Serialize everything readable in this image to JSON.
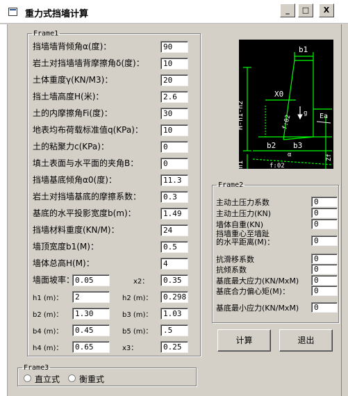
{
  "window": {
    "title": "重力式挡墙计算",
    "minimize_label": "_",
    "maximize_label": "□",
    "close_label": "X"
  },
  "frame1": {
    "legend": "Frame1",
    "rows": [
      {
        "label": "挡墙墙背倾角α(度)：",
        "value": "90"
      },
      {
        "label": "岩土对挡墙墙背摩擦角δ(度)：",
        "value": "10"
      },
      {
        "label": "土体重度γ(KN/M3)：",
        "value": "20"
      },
      {
        "label": "挡土墙高度H(米)：",
        "value": "2.6"
      },
      {
        "label": "土的内摩擦角Fi(度)：",
        "value": "30"
      },
      {
        "label": "地表均布荷载标准值q(KPa)：",
        "value": "10"
      },
      {
        "label": "土的粘聚力c(KPa)：",
        "value": "0"
      },
      {
        "label": "填土表面与水平面的夹角B：",
        "value": "0"
      },
      {
        "label": "挡墙基底倾角α0(度)：",
        "value": "11.3"
      },
      {
        "label": "岩土对挡墙基底的摩擦系数：",
        "value": "0.3"
      },
      {
        "label": "基底的水平投影宽度b(m)：",
        "value": "1.49"
      },
      {
        "label": "挡墙材料重度(KN/M)：",
        "value": "24"
      },
      {
        "label": "墙顶宽度b1(M)：",
        "value": "0.5"
      },
      {
        "label": "墙体总高H(M)：",
        "value": "4"
      }
    ],
    "pairs": [
      {
        "l1": "墙面坡率：",
        "v1": "0.05",
        "l2": "x2：",
        "v2": "0.35"
      },
      {
        "l1": "h1 (m)：",
        "v1": "2",
        "l2": "h2 (m)：",
        "v2": "0.298"
      },
      {
        "l1": "b2 (m)：",
        "v1": "1.30",
        "l2": "b3 (m)：",
        "v2": "1.03"
      },
      {
        "l1": "b4 (m)：",
        "v1": "0.45",
        "l2": "b5 (m)：",
        "v2": ".5"
      },
      {
        "l1": "h4 (m)：",
        "v1": "0.65",
        "l2": "x3：",
        "v2": "0.25"
      }
    ]
  },
  "diagram": {
    "labels": {
      "b1": "b1",
      "x0": "X0",
      "g": "g",
      "f02": "f:02",
      "ea": "Ea",
      "b2": "b2",
      "b3": "b3",
      "hh": "H-h1-h2",
      "h1": "h1",
      "zf": "Zf",
      "alpha": "α",
      "bottom": "f:02"
    }
  },
  "frame2": {
    "legend": "Frame2",
    "rows": [
      {
        "label": "主动土压力系数",
        "value": "0"
      },
      {
        "label": "主动土压力(KN)",
        "value": "0"
      },
      {
        "label": "墙体自重(KN)",
        "value": "0"
      },
      {
        "label": "挡墙重心至墙趾的水平距离(M)：",
        "value": "0"
      },
      {
        "label": "抗滑移系数",
        "value": "0"
      },
      {
        "label": "抗倾系数",
        "value": "0"
      },
      {
        "label": "基底最大应力(KN/MxM)",
        "value": "0"
      },
      {
        "label": "基底合力偏心矩(M)：",
        "value": "0"
      },
      {
        "label": "基底最小应力(KN/MxM)",
        "value": "0"
      }
    ],
    "label4_line1": "挡墙重心至墙趾",
    "label4_line2": "的水平距离(M)："
  },
  "buttons": {
    "calc": "计算",
    "exit": "退出"
  },
  "frame3": {
    "legend": "Frame3",
    "options": [
      "直立式",
      "衡重式"
    ]
  }
}
